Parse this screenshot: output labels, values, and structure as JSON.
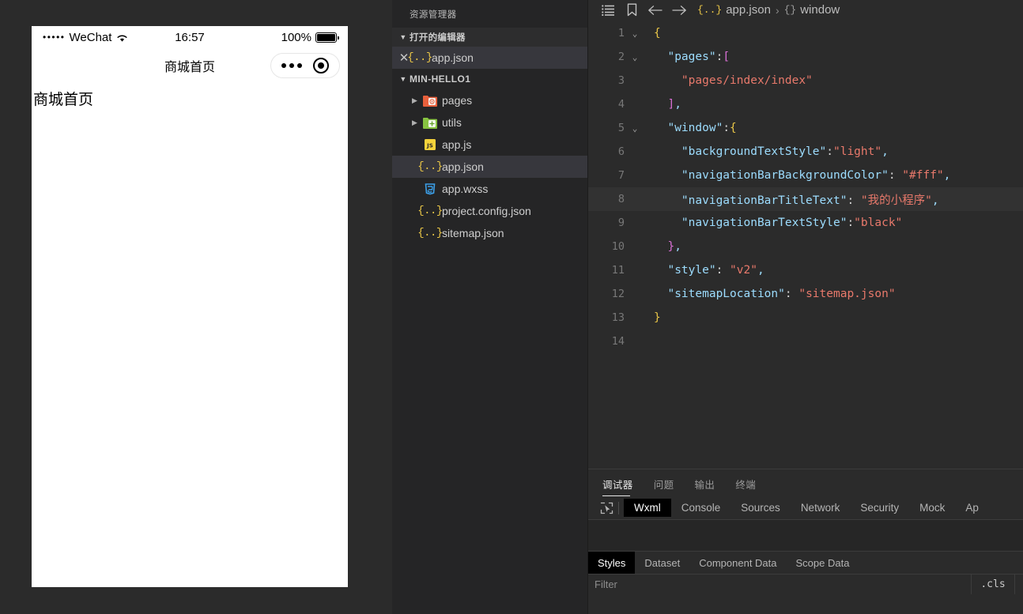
{
  "simulator": {
    "status_bar": {
      "signal_dots": "•••••",
      "carrier": "WeChat",
      "wifi_icon": "wifi-icon",
      "time": "16:57",
      "battery_percent": "100%",
      "battery_icon": "battery-full-icon"
    },
    "nav_bar": {
      "title": "商城首页",
      "capsule": {
        "menu_icon": "more-dots-icon",
        "target_icon": "target-circle-icon"
      }
    },
    "page_content": {
      "text": "商城首页"
    }
  },
  "explorer": {
    "title": "资源管理器",
    "open_editors": {
      "label": "打开的编辑器",
      "twisty_icon": "chevron-down-icon",
      "items": [
        {
          "close_icon": "close-icon",
          "file_icon": "json-file-icon",
          "name": "app.json",
          "selected": true
        }
      ]
    },
    "project": {
      "name": "MIN-HELLO1",
      "twisty_icon": "chevron-down-icon",
      "items": [
        {
          "arrow_icon": "chevron-right-icon",
          "file_icon": "folder-pages-icon",
          "name": "pages",
          "kind": "folder-orange",
          "selected": false
        },
        {
          "arrow_icon": "chevron-right-icon",
          "file_icon": "folder-utils-icon",
          "name": "utils",
          "kind": "folder-green",
          "selected": false
        },
        {
          "arrow_icon": "",
          "file_icon": "js-file-icon",
          "name": "app.js",
          "kind": "js",
          "selected": false
        },
        {
          "arrow_icon": "",
          "file_icon": "json-file-icon",
          "name": "app.json",
          "kind": "json",
          "selected": true
        },
        {
          "arrow_icon": "",
          "file_icon": "wxss-file-icon",
          "name": "app.wxss",
          "kind": "wxss",
          "selected": false
        },
        {
          "arrow_icon": "",
          "file_icon": "json-file-icon",
          "name": "project.config.json",
          "kind": "json",
          "selected": false
        },
        {
          "arrow_icon": "",
          "file_icon": "json-file-icon",
          "name": "sitemap.json",
          "kind": "json",
          "selected": false
        }
      ]
    }
  },
  "editor": {
    "toolbar": {
      "outline_icon": "list-outline-icon",
      "bookmark_icon": "bookmark-icon",
      "back_icon": "arrow-left-icon",
      "forward_icon": "arrow-right-icon"
    },
    "breadcrumb": {
      "file_icon": "json-file-icon",
      "file": "app.json",
      "separator": "›",
      "node_icon": "{}",
      "node": "window"
    },
    "lines": [
      {
        "n": "1",
        "fold": "⌄",
        "text": "{"
      },
      {
        "n": "2",
        "fold": "⌄",
        "text": "  \"pages\":["
      },
      {
        "n": "3",
        "fold": "",
        "text": "    \"pages/index/index\""
      },
      {
        "n": "4",
        "fold": "",
        "text": "  ],"
      },
      {
        "n": "5",
        "fold": "⌄",
        "text": "  \"window\":{"
      },
      {
        "n": "6",
        "fold": "",
        "text": "    \"backgroundTextStyle\":\"light\","
      },
      {
        "n": "7",
        "fold": "",
        "text": "    \"navigationBarBackgroundColor\": \"#fff\","
      },
      {
        "n": "8",
        "fold": "",
        "text": "    \"navigationBarTitleText\": \"我的小程序\","
      },
      {
        "n": "9",
        "fold": "",
        "text": "    \"navigationBarTextStyle\":\"black\""
      },
      {
        "n": "10",
        "fold": "",
        "text": "  },"
      },
      {
        "n": "11",
        "fold": "",
        "text": "  \"style\": \"v2\","
      },
      {
        "n": "12",
        "fold": "",
        "text": "  \"sitemapLocation\": \"sitemap.json\""
      },
      {
        "n": "13",
        "fold": "",
        "text": "}"
      },
      {
        "n": "14",
        "fold": "",
        "text": ""
      }
    ]
  },
  "bottom_panel": {
    "panel_tabs": [
      {
        "label": "调试器",
        "active": true
      },
      {
        "label": "问题",
        "active": false
      },
      {
        "label": "输出",
        "active": false
      },
      {
        "label": "终端",
        "active": false
      }
    ],
    "picker_icon": "element-picker-icon",
    "devtools_tabs": [
      {
        "label": "Wxml",
        "active": true
      },
      {
        "label": "Console",
        "active": false
      },
      {
        "label": "Sources",
        "active": false
      },
      {
        "label": "Network",
        "active": false
      },
      {
        "label": "Security",
        "active": false
      },
      {
        "label": "Mock",
        "active": false
      },
      {
        "label": "Ap",
        "active": false
      }
    ],
    "styles_tabs": [
      {
        "label": "Styles",
        "active": true
      },
      {
        "label": "Dataset",
        "active": false
      },
      {
        "label": "Component Data",
        "active": false
      },
      {
        "label": "Scope Data",
        "active": false
      }
    ],
    "filter": {
      "placeholder": "Filter",
      "value": ""
    },
    "cls_button": ".cls"
  },
  "colors": {
    "editor_bg": "#2b2b2b",
    "sidebar_bg": "#252526",
    "selection_bg": "#37373d",
    "accent_yellow": "#e8c547",
    "string_red": "#e8796b",
    "key_blue": "#9cdcfe",
    "bracket_pink": "#da70d6"
  }
}
